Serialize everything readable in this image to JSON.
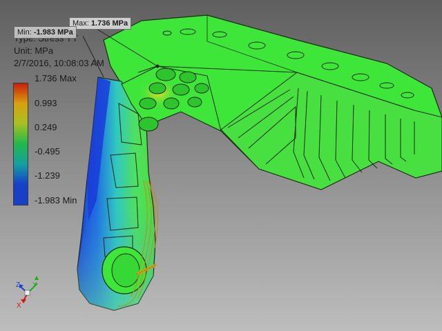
{
  "result": {
    "type_line": "Type: Stress YY",
    "unit_line": "Unit: MPa",
    "date_line": "2/7/2016, 10:08:03 AM"
  },
  "flags": {
    "max": {
      "prefix": "Max: ",
      "value": "1.736 MPa"
    },
    "min": {
      "prefix": "Min: ",
      "value": "-1.983 MPa"
    }
  },
  "legend": {
    "labels": [
      "1.736 Max",
      "0.993",
      "0.249",
      "-0.495",
      "-1.239",
      "-1.983 Min"
    ],
    "colors": [
      "#c81e0a",
      "#d8a010",
      "#a8c020",
      "#22b84a",
      "#16a0a0",
      "#1640c8"
    ]
  },
  "axes": {
    "x": "X",
    "y": "Y",
    "z": "Z",
    "x_color": "#d01818",
    "y_color": "#18b018",
    "z_color": "#1840d0"
  },
  "colors": {
    "part_green": "#3ee63a",
    "edge_dark": "#1a2a12",
    "stress_blue": "#1a3cd8",
    "load_spring": "#c08a20"
  }
}
